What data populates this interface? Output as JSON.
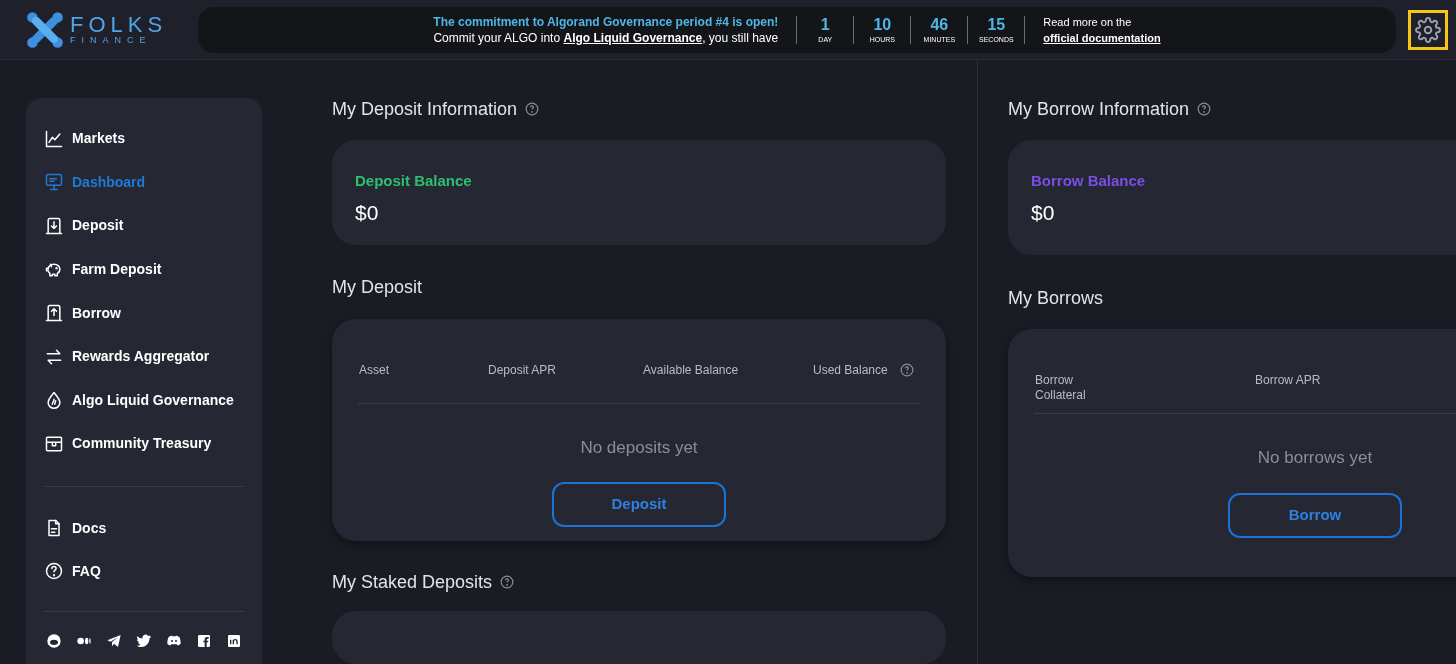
{
  "header": {
    "logo": {
      "name": "FOLKS",
      "sub": "FINANCE"
    },
    "banner": {
      "headline": "The commitment to Algorand Governance period #4 is open!",
      "message_before": "Commit your ALGO into",
      "message_link": "Algo Liquid Governance",
      "message_after": ", you still have",
      "countdown": [
        {
          "value": "1",
          "unit": "DAY"
        },
        {
          "value": "10",
          "unit": "HOURS"
        },
        {
          "value": "46",
          "unit": "MINUTES"
        },
        {
          "value": "15",
          "unit": "SECONDS"
        }
      ],
      "docs_text": "Read more on the",
      "docs_link": "official documentation"
    }
  },
  "sidebar": {
    "items": [
      {
        "label": "Markets",
        "selected": false
      },
      {
        "label": "Dashboard",
        "selected": true
      },
      {
        "label": "Deposit",
        "selected": false
      },
      {
        "label": "Farm Deposit",
        "selected": false
      },
      {
        "label": "Borrow",
        "selected": false
      },
      {
        "label": "Rewards Aggregator",
        "selected": false
      },
      {
        "label": "Algo Liquid Governance",
        "selected": false
      },
      {
        "label": "Community Treasury",
        "selected": false
      }
    ],
    "secondary": [
      {
        "label": "Docs"
      },
      {
        "label": "FAQ"
      }
    ]
  },
  "deposit": {
    "info_title": "My Deposit Information",
    "balance_label": "Deposit Balance",
    "balance": "$0",
    "list_title": "My Deposit",
    "columns": [
      {
        "label": "Asset",
        "help": false
      },
      {
        "label": "Deposit APR",
        "help": false
      },
      {
        "label": "Available Balance",
        "help": false
      },
      {
        "label": "Used Balance",
        "help": true
      }
    ],
    "empty_text": "No deposits yet",
    "button": "Deposit",
    "staked_title": "My Staked Deposits"
  },
  "borrow": {
    "info_title": "My Borrow Information",
    "balance_label": "Borrow Balance",
    "balance": "$0",
    "list_title": "My Borrows",
    "columns": [
      {
        "label": "Borrow Collateral",
        "help": false
      },
      {
        "label": "Borrow APR",
        "help": false
      }
    ],
    "empty_text": "No borrows yet",
    "button": "Borrow"
  }
}
